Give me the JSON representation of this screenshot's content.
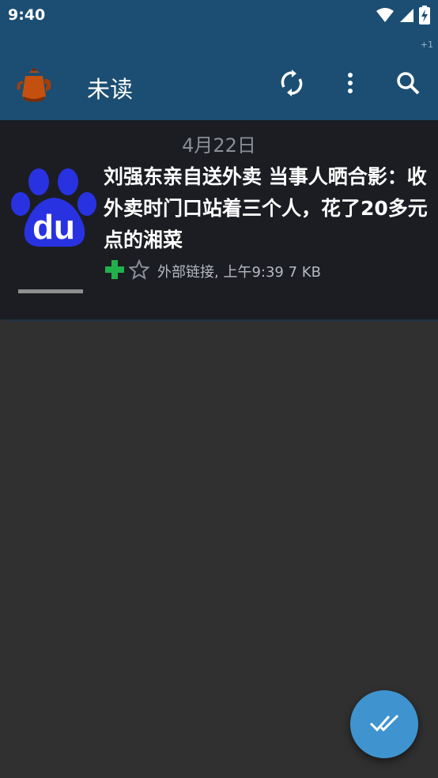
{
  "status_bar": {
    "time": "9:40",
    "wifi_icon": "wifi-icon",
    "signal_icon": "signal-icon",
    "battery_icon": "battery-charging-icon",
    "notification_badge": "+1"
  },
  "toolbar": {
    "logo_icon": "teapot-logo-icon",
    "title": "未读",
    "refresh_icon": "refresh-icon",
    "more_icon": "more-vertical-icon",
    "search_icon": "search-icon"
  },
  "feed": {
    "date_header": "4月22日",
    "articles": [
      {
        "thumbnail_icon": "baidu-paw-icon",
        "thumbnail_text": "du",
        "title": "刘强东亲自送外卖 当事人晒合影：收外卖时门口站着三个人，花了20多元点的湘菜",
        "meta": "外部链接, 上午9:39 7 KB",
        "add_icon": "plus-icon",
        "star_icon": "star-outline-icon"
      }
    ]
  },
  "fab": {
    "icon": "mark-all-read-icon"
  },
  "colors": {
    "toolbar_bg": "#1b4e72",
    "card_bg": "#1b1d22",
    "page_bg": "#303030",
    "fab_bg": "#3f94cf",
    "baidu_blue": "#2932e1",
    "plus_green": "#22b14c"
  }
}
